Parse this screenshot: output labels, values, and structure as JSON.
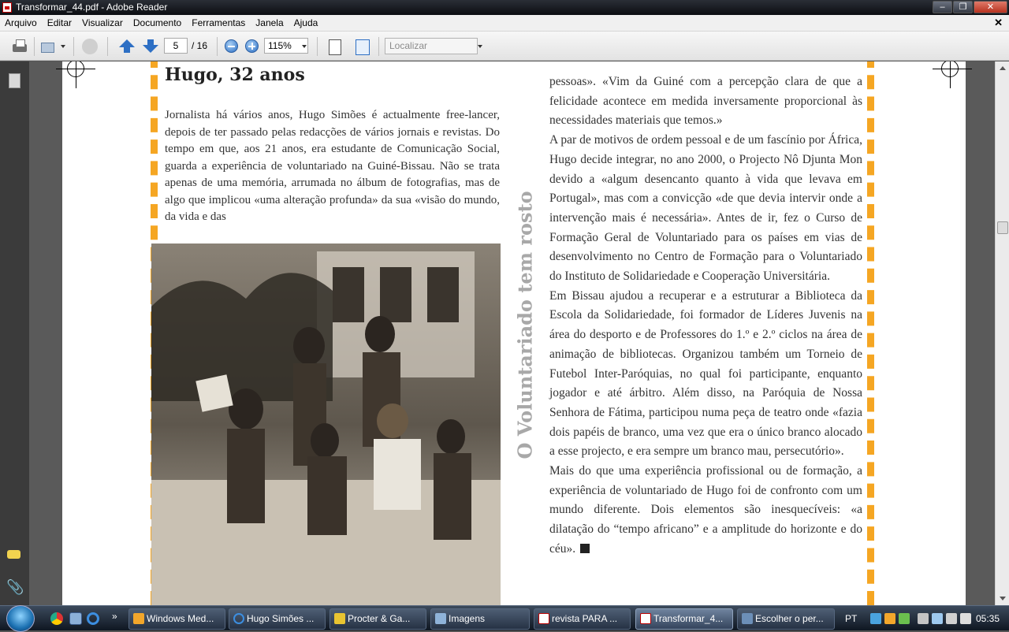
{
  "window": {
    "title": "Transformar_44.pdf - Adobe Reader"
  },
  "menu": [
    "Arquivo",
    "Editar",
    "Visualizar",
    "Documento",
    "Ferramentas",
    "Janela",
    "Ajuda"
  ],
  "toolbar": {
    "page_current": "5",
    "page_total": "/ 16",
    "zoom": "115%",
    "search_placeholder": "Localizar"
  },
  "document": {
    "headline": "Hugo, 32 anos",
    "sidebar_title": "O Voluntariado tem rosto",
    "left_paragraph": "Jornalista há vários anos, Hugo Simões é actualmente free-lancer, depois de ter passado pelas redacções de vários jornais e revistas. Do tempo em que, aos 21 anos, era estudante de Comunicação Social, guarda a experiência de voluntariado na Guiné-Bissau. Não se trata apenas de uma memória, arrumada no álbum de fotografias, mas de algo que implicou «uma alteração profunda» da sua «visão do mundo, da vida e das",
    "right_paragraphs": [
      "pessoas». «Vim da Guiné com a percepção clara de que a felicidade acontece em medida inversamente proporcional às necessidades materiais que temos.»",
      "A par de motivos de ordem pessoal e de um fascínio por África, Hugo decide integrar, no ano 2000, o Projecto Nô Djunta Mon devido a «algum desencanto quanto à vida que levava em Portugal», mas com a convicção «de que devia intervir onde a intervenção mais é necessária». Antes de ir, fez o Curso de Formação Geral de Voluntariado para os países em vias de desenvolvimento no Centro de Formação para o Voluntariado do Instituto de Solidariedade e Cooperação Universitária.",
      "Em Bissau ajudou a recuperar e a estruturar a Biblioteca da Escola da Solidariedade, foi formador de Líderes Juvenis na área do desporto e de Professores do 1.º e 2.º ciclos na área de animação de bibliotecas. Organizou também um Torneio de Futebol Inter-Paróquias, no qual foi participante, enquanto jogador e até árbitro. Além disso, na Paróquia de Nossa Senhora de Fátima, participou numa peça de teatro onde «fazia dois papéis de branco, uma vez que era o único branco alocado a esse projecto, e era sempre um branco mau, persecutório».",
      "Mais do que uma experiência profissional ou de formação, a experiência de voluntariado de Hugo foi de confronto com um mundo diferente. Dois elementos são inesquecíveis: «a dilatação do “tempo africano” e a amplitude do horizonte e do céu»."
    ]
  },
  "taskbar": {
    "tasks": [
      "Windows Med...",
      "Hugo Simões ...",
      "Procter & Ga...",
      "Imagens",
      "revista PARA ...",
      "Transformar_4...",
      "Escolher o per..."
    ],
    "lang": "PT",
    "clock": "05:35"
  },
  "colors": {
    "accent_orange": "#f5a623",
    "sidebar_gray": "#a8a8a8"
  }
}
